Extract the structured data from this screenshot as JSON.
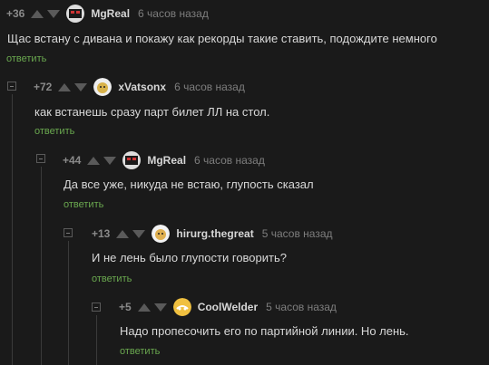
{
  "comments": [
    {
      "score": "+36",
      "author": "MgReal",
      "time": "6 часов назад",
      "text": "Щас встану с дивана и покажу как рекорды такие ставить, подождите немного",
      "reply": "ответить"
    },
    {
      "score": "+72",
      "author": "xVatsonx",
      "time": "6 часов назад",
      "text": "как встанешь сразу парт билет ЛЛ на стол.",
      "reply": "ответить"
    },
    {
      "score": "+44",
      "author": "MgReal",
      "time": "6 часов назад",
      "text": "Да все уже, никуда не встаю, глупость сказал",
      "reply": "ответить"
    },
    {
      "score": "+13",
      "author": "hirurg.thegreat",
      "time": "5 часов назад",
      "text": "И не лень было глупости говорить?",
      "reply": "ответить"
    },
    {
      "score": "+5",
      "author": "CoolWelder",
      "time": "5 часов назад",
      "text": "Надо пропесочить его по партийной линии. Но лень.",
      "reply": "ответить"
    }
  ]
}
